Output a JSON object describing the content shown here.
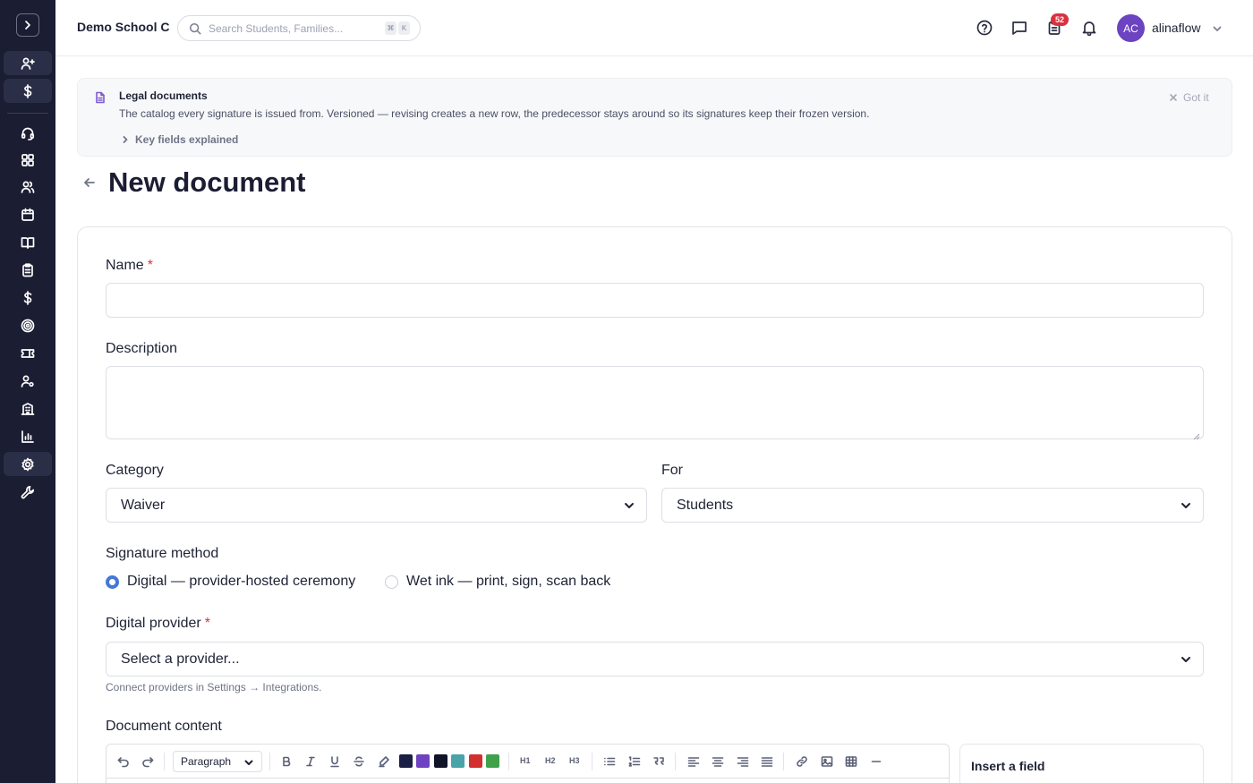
{
  "header": {
    "school_name": "Demo School C",
    "search_placeholder": "Search Students, Families...",
    "shortcut_keys": [
      "⌘",
      "K"
    ],
    "notification_count": "52",
    "user": {
      "initials": "AC",
      "name": "alinaflow"
    }
  },
  "sidebar": {
    "items": [
      {
        "icon": "user-plus-icon"
      },
      {
        "icon": "dollar-icon"
      },
      {
        "icon": "headset-icon"
      },
      {
        "icon": "dashboard-icon"
      },
      {
        "icon": "users-icon"
      },
      {
        "icon": "calendar-icon"
      },
      {
        "icon": "book-icon"
      },
      {
        "icon": "clipboard-icon"
      },
      {
        "icon": "dollar-icon"
      },
      {
        "icon": "target-icon"
      },
      {
        "icon": "ticket-icon"
      },
      {
        "icon": "user-settings-icon"
      },
      {
        "icon": "building-icon"
      },
      {
        "icon": "chart-icon"
      },
      {
        "icon": "gear-icon"
      },
      {
        "icon": "wrench-icon"
      }
    ]
  },
  "banner": {
    "title": "Legal documents",
    "text": "The catalog every signature is issued from. Versioned — revising creates a new row, the predecessor stays around so its signatures keep their frozen version.",
    "toggle_label": "Key fields explained",
    "dismiss_label": "Got it"
  },
  "page": {
    "title": "New document"
  },
  "form": {
    "name": {
      "label": "Name",
      "required_mark": "*",
      "value": ""
    },
    "description": {
      "label": "Description",
      "value": ""
    },
    "category": {
      "label": "Category",
      "value": "Waiver"
    },
    "for": {
      "label": "For",
      "value": "Students"
    },
    "signature_method": {
      "label": "Signature method",
      "options": [
        "Digital — provider-hosted ceremony",
        "Wet ink — print, sign, scan back"
      ],
      "selected": "Digital — provider-hosted ceremony"
    },
    "digital_provider": {
      "label": "Digital provider",
      "required_mark": "*",
      "placeholder": "Select a provider...",
      "help": "Connect providers in Settings → Integrations."
    },
    "document_content": {
      "label": "Document content",
      "block_type": "Paragraph",
      "heading_buttons": [
        "H1",
        "H2",
        "H3"
      ],
      "colors": [
        "#1b1f45",
        "#6f42c1",
        "#111427",
        "#4aa3a8",
        "#d32f2f",
        "#3fa14a"
      ]
    },
    "insert_field": {
      "title": "Insert a field"
    }
  }
}
